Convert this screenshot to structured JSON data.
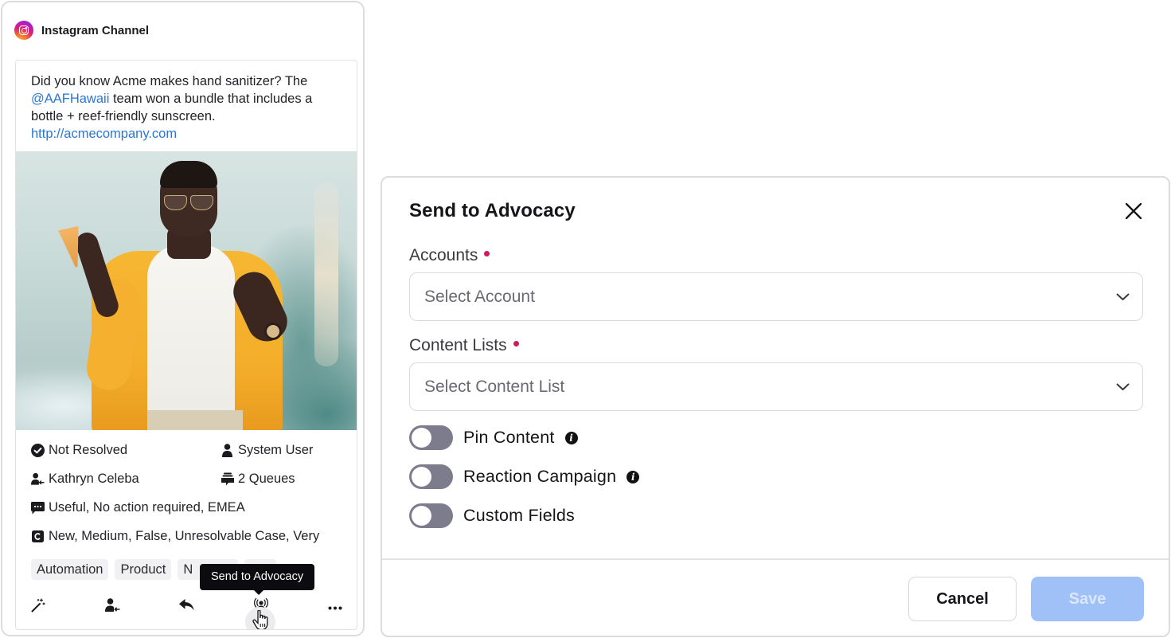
{
  "post_card": {
    "channel": {
      "icon": "instagram-icon",
      "name": "Instagram Channel"
    },
    "message": {
      "text_before_mention": "Did you know Acme makes hand sanitizer? The ",
      "mention": "@AAFHawaii",
      "text_after_mention": " team won a bundle that includes a bottle + reef-friendly sunscreen.",
      "link": "http://acmecompany.com"
    },
    "image": {
      "description": "Person in yellow jacket and sunglasses holding an ice cream cone against a teal wall"
    },
    "meta": {
      "status": {
        "icon": "check-circle-icon",
        "text": "Not Resolved"
      },
      "user": {
        "icon": "user-icon",
        "text": "System User"
      },
      "assignee": {
        "icon": "assign-user-icon",
        "text": "Kathryn Celeba"
      },
      "queues": {
        "icon": "queues-icon",
        "text": "2 Queues"
      },
      "categories": {
        "icon": "comment-icon",
        "text": "Useful, No action required, EMEA"
      },
      "custom": {
        "icon": "case-icon",
        "text": "New, Medium, False, Unresolvable Case, Very"
      }
    },
    "tags": [
      "Automation",
      "Product",
      "N"
    ],
    "tooltip": "Send to Advocacy",
    "actions": [
      {
        "name": "magic-wand-icon",
        "label": "Suggestions"
      },
      {
        "name": "assign-user-icon",
        "label": "Assign"
      },
      {
        "name": "reply-icon",
        "label": "Reply"
      },
      {
        "name": "advocacy-broadcast-icon",
        "label": "Send to Advocacy"
      },
      {
        "name": "more-icon",
        "label": "More"
      }
    ]
  },
  "dialog": {
    "title": "Send to Advocacy",
    "close_icon": "close-icon",
    "fields": {
      "accounts": {
        "label": "Accounts",
        "required": true,
        "placeholder": "Select Account"
      },
      "content_lists": {
        "label": "Content Lists",
        "required": true,
        "placeholder": "Select Content List"
      }
    },
    "toggles": [
      {
        "label": "Pin Content",
        "on": false,
        "info": true
      },
      {
        "label": "Reaction Campaign",
        "on": false,
        "info": true
      },
      {
        "label": "Custom Fields",
        "on": false,
        "info": false
      }
    ],
    "buttons": {
      "cancel": "Cancel",
      "save": "Save",
      "save_disabled": true
    }
  },
  "colors": {
    "link": "#2a76d6",
    "required_dot": "#d01a5c",
    "toggle_off": "#7c7c8c",
    "save_disabled_bg": "#9fc1f7",
    "tooltip_bg": "#0c0c10"
  }
}
